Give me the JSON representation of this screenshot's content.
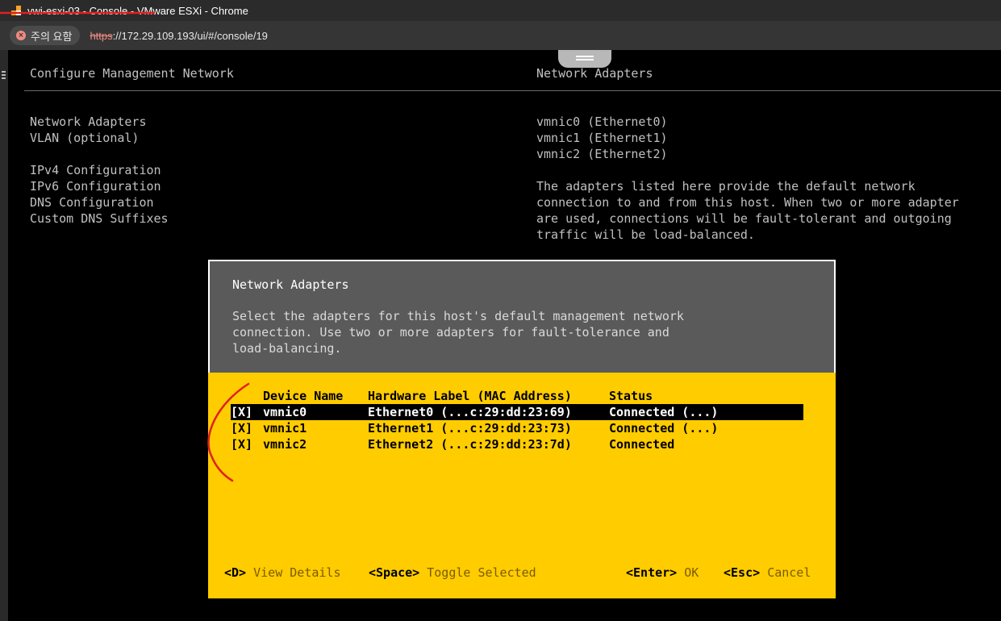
{
  "browser": {
    "window_title": "vwi-esxi-03 - Console - VMware ESXi - Chrome",
    "security_chip": "주의 요함",
    "url_scheme": "https",
    "url_rest": "://172.29.109.193/ui/#/console/19"
  },
  "console": {
    "left_title": "Configure Management Network",
    "right_title": "Network Adapters",
    "menu_items": [
      "Network Adapters",
      "VLAN (optional)",
      "",
      "IPv4 Configuration",
      "IPv6 Configuration",
      "DNS Configuration",
      "Custom DNS Suffixes"
    ],
    "adapters_summary": [
      "vmnic0 (Ethernet0)",
      "vmnic1 (Ethernet1)",
      "vmnic2 (Ethernet2)"
    ],
    "help_text": [
      "The adapters listed here provide the default network",
      "connection to and from this host. When two or more adapter",
      "are used, connections will be fault-tolerant and outgoing",
      "traffic will be load-balanced."
    ]
  },
  "dialog": {
    "title": "Network Adapters",
    "description": [
      "Select the adapters for this host's default management network",
      "connection. Use two or more adapters for fault-tolerance and",
      "load-balancing."
    ],
    "columns": {
      "device": "Device Name",
      "hardware": "Hardware Label (MAC Address)",
      "status": "Status"
    },
    "rows": [
      {
        "check": "[X]",
        "device": "vmnic0",
        "hardware": "Ethernet0 (...c:29:dd:23:69)",
        "status": "Connected (...)"
      },
      {
        "check": "[X]",
        "device": "vmnic1",
        "hardware": "Ethernet1 (...c:29:dd:23:73)",
        "status": "Connected (...)"
      },
      {
        "check": "[X]",
        "device": "vmnic2",
        "hardware": "Ethernet2 (...c:29:dd:23:7d)",
        "status": "Connected"
      }
    ],
    "keys": [
      {
        "key": "<D>",
        "action": "View Details"
      },
      {
        "key": "<Space>",
        "action": "Toggle Selected"
      },
      {
        "key": "<Enter>",
        "action": "OK"
      },
      {
        "key": "<Esc>",
        "action": "Cancel"
      }
    ]
  },
  "colors": {
    "dialog_bg": "#ffcc00",
    "dialog_header": "#5a5a5a",
    "annotation": "#e02020"
  }
}
